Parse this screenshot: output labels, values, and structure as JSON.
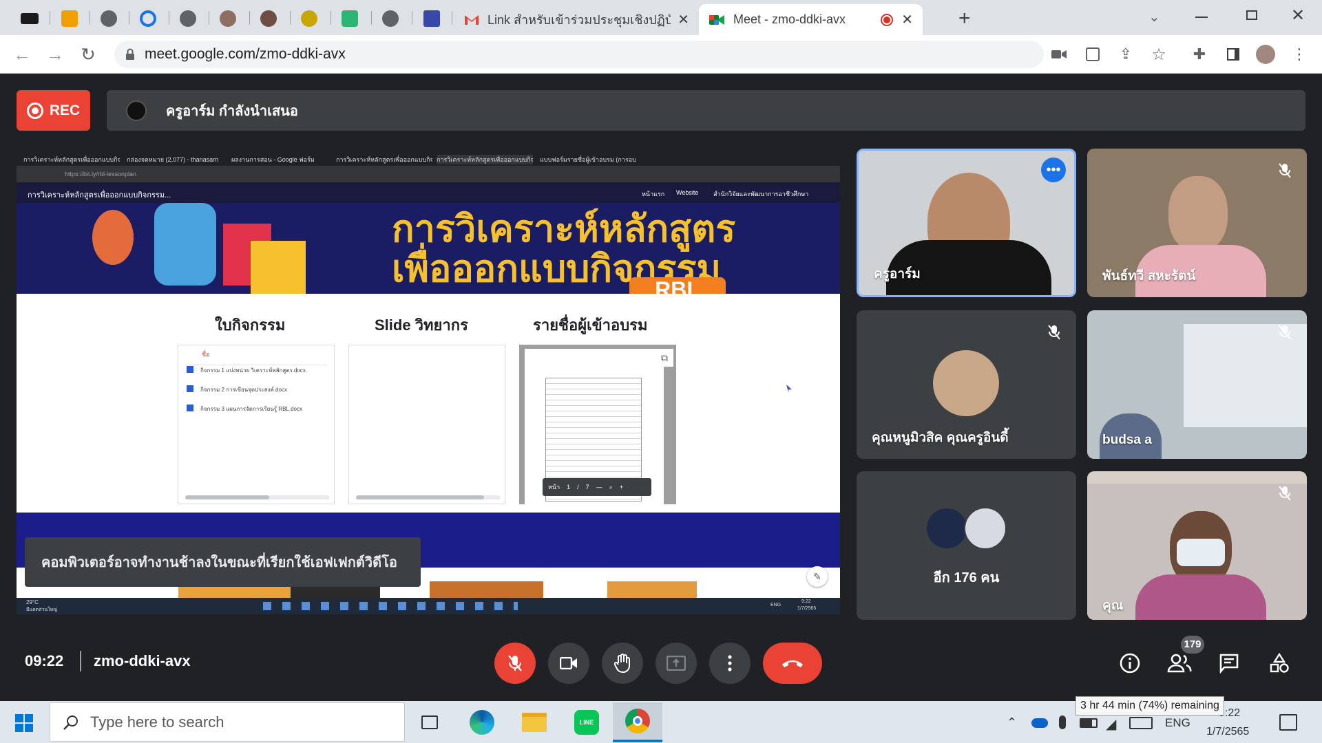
{
  "browser": {
    "tabs": [
      {
        "label": "Link สำหรับเข้าร่วมประชุมเชิงปฏิบัติก",
        "icon": "gmail-icon"
      },
      {
        "label": "Meet - zmo-ddki-avx",
        "icon": "meet-icon",
        "recording": true
      }
    ],
    "url": "meet.google.com/zmo-ddki-avx"
  },
  "meet": {
    "rec_label": "REC",
    "presenting_text": "ครูอาร์ม กำลังนำเสนอ",
    "time": "09:22",
    "meeting_code": "zmo-ddki-avx",
    "people_count": "179",
    "toast": "คอมพิวเตอร์อาจทำงานช้าลงในขณะที่เรียกใช้เอฟเฟกต์วิดีโอ",
    "participants": [
      {
        "name": "ครูอาร์ม",
        "muted": false,
        "active": true
      },
      {
        "name": "พันธ์ทวี สหะรัตน์",
        "muted": true
      },
      {
        "name": "คุณหนูมิวสิค คุณครูอินดี้",
        "muted": true
      },
      {
        "name": "budsa a",
        "muted": true
      },
      {
        "name": "อีก 176 คน",
        "muted": false
      },
      {
        "name": "คุณ",
        "muted": true
      }
    ]
  },
  "shared": {
    "tabs": [
      "การวิเคราะห์หลักสูตรเพื่อออกแบบกิจ",
      "กล่องจดหมาย (2,077) - thanasarn",
      "ผลงานการสอน - Google ฟอร์ม",
      "การวิเคราะห์หลักสูตรเพื่อออกแบบกิจ",
      "การวิเคราะห์หลักสูตรเพื่อออกแบบกิจ",
      "แบบฟอร์มรายชื่อผู้เข้าอบรม (การอบรม"
    ],
    "url": "https://bit.ly/rbl-lessonplan",
    "site_title": "การวิเคราะห์หลักสูตรเพื่อออกแบบกิจกรรม...",
    "nav": [
      "หน้าแรก",
      "Website",
      "สำนักวิจัยและพัฒนาการอาชีวศึกษา"
    ],
    "banner_line1": "การวิเคราะห์หลักสูตร",
    "banner_line2": "เพื่อออกแบบกิจกรรม",
    "banner_badge": "RBL",
    "section_headers": [
      "ใบกิจกรรม",
      "Slide วิทยากร",
      "รายชื่อผู้เข้าอบรม"
    ],
    "files_header": "ชื่อ",
    "files": [
      "กิจกรรม 1 แบ่งหน่วย วิเคราะห์หลักสูตร.docx",
      "กิจกรรม 2 การเขียนจุดประสงค์.docx",
      "กิจกรรม 3 แผนการจัดการเรียนรู้ RBL.docx"
    ],
    "pdf_page_label": "หน้า",
    "pdf_page": "1",
    "pdf_total": "7",
    "weather_temp": "29°C",
    "weather_desc": "มีแดดส่วนใหญ่",
    "sys_lang": "ENG",
    "sys_time": "9:22",
    "sys_date": "1/7/2565"
  },
  "taskbar": {
    "search_placeholder": "Type here to search",
    "lang": "ENG",
    "date": "1/7/2565",
    "time": "9:22",
    "battery_tooltip": "3 hr 44 min (74%) remaining"
  },
  "colors": {
    "accent": "#8ab4f8",
    "danger": "#ea4335",
    "tile": "#3c4043"
  }
}
